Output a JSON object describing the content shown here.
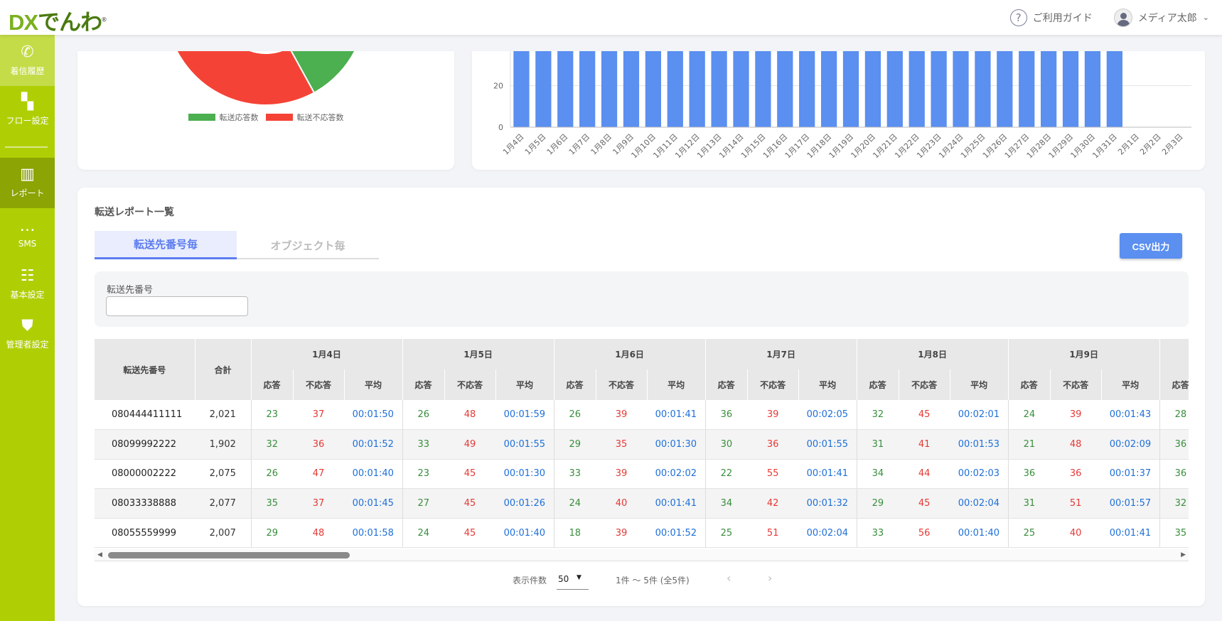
{
  "header": {
    "logo_dx": "DX",
    "logo_rest": "でんわ",
    "guide": "ご利用ガイド",
    "user": "メディア太郎"
  },
  "sidebar": {
    "items": [
      {
        "label": "着信履歴",
        "icon": "phone-icon"
      },
      {
        "label": "フロー設定",
        "icon": "flow-icon"
      },
      {
        "label": "レポート",
        "icon": "bar-chart-icon"
      },
      {
        "label": "SMS",
        "icon": "message-icon"
      },
      {
        "label": "基本設定",
        "icon": "sliders-icon"
      },
      {
        "label": "管理者設定",
        "icon": "admin-shield-icon"
      }
    ]
  },
  "chart_data": [
    {
      "type": "pie",
      "series": [
        {
          "name": "転送応答数",
          "color": "#4caf50",
          "share": 0.42
        },
        {
          "name": "転送不応答数",
          "color": "#f44336",
          "share": 0.58
        }
      ],
      "legend": "bottom"
    },
    {
      "type": "bar",
      "color": "#5b8ff0",
      "categories": [
        "1月4日",
        "1月5日",
        "1月6日",
        "1月7日",
        "1月8日",
        "1月9日",
        "1月10日",
        "1月11日",
        "1月12日",
        "1月13日",
        "1月14日",
        "1月15日",
        "1月16日",
        "1月17日",
        "1月18日",
        "1月19日",
        "1月20日",
        "1月21日",
        "1月22日",
        "1月23日",
        "1月24日",
        "1月25日",
        "1月26日",
        "1月27日",
        "1月28日",
        "1月29日",
        "1月30日",
        "1月31日",
        "2月1日",
        "2月2日",
        "2月3日"
      ],
      "values": [
        ">37",
        ">37",
        ">37",
        ">37",
        ">37",
        ">37",
        ">37",
        ">37",
        ">37",
        ">37",
        ">37",
        ">37",
        ">37",
        ">37",
        ">37",
        ">37",
        ">37",
        ">37",
        ">37",
        ">37",
        ">37",
        ">37",
        ">37",
        ">37",
        ">37",
        ">37",
        ">37",
        ">37",
        0,
        0,
        0
      ],
      "yticks": [
        "0",
        "20"
      ],
      "grid": true
    }
  ],
  "report": {
    "title": "転送レポート一覧",
    "tabs": [
      "転送先番号毎",
      "オブジェクト毎"
    ],
    "csv": "CSV出力",
    "filter_label": "転送先番号",
    "filter_value": "",
    "table": {
      "col_number": "転送先番号",
      "col_total": "合計",
      "sub": [
        "応答",
        "不応答",
        "平均"
      ],
      "dates": [
        "1月4日",
        "1月5日",
        "1月6日",
        "1月7日",
        "1月8日",
        "1月9日"
      ],
      "rows": [
        {
          "number": "080444411111",
          "total": "2,021",
          "cells": [
            [
              "23",
              "37",
              "00:01:50"
            ],
            [
              "26",
              "48",
              "00:01:59"
            ],
            [
              "26",
              "39",
              "00:01:41"
            ],
            [
              "36",
              "39",
              "00:02:05"
            ],
            [
              "32",
              "45",
              "00:02:01"
            ],
            [
              "24",
              "39",
              "00:01:43"
            ]
          ],
          "next": "28"
        },
        {
          "number": "08099992222",
          "total": "1,902",
          "cells": [
            [
              "32",
              "36",
              "00:01:52"
            ],
            [
              "33",
              "49",
              "00:01:55"
            ],
            [
              "29",
              "35",
              "00:01:30"
            ],
            [
              "30",
              "36",
              "00:01:55"
            ],
            [
              "31",
              "41",
              "00:01:53"
            ],
            [
              "21",
              "48",
              "00:02:09"
            ]
          ],
          "next": "36"
        },
        {
          "number": "08000002222",
          "total": "2,075",
          "cells": [
            [
              "26",
              "47",
              "00:01:40"
            ],
            [
              "23",
              "45",
              "00:01:30"
            ],
            [
              "33",
              "39",
              "00:02:02"
            ],
            [
              "22",
              "55",
              "00:01:41"
            ],
            [
              "34",
              "44",
              "00:02:03"
            ],
            [
              "36",
              "36",
              "00:01:37"
            ]
          ],
          "next": "36"
        },
        {
          "number": "08033338888",
          "total": "2,077",
          "cells": [
            [
              "35",
              "37",
              "00:01:45"
            ],
            [
              "27",
              "45",
              "00:01:26"
            ],
            [
              "24",
              "40",
              "00:01:41"
            ],
            [
              "34",
              "42",
              "00:01:32"
            ],
            [
              "29",
              "45",
              "00:02:04"
            ],
            [
              "31",
              "51",
              "00:01:57"
            ]
          ],
          "next": "32"
        },
        {
          "number": "08055559999",
          "total": "2,007",
          "cells": [
            [
              "29",
              "48",
              "00:01:58"
            ],
            [
              "24",
              "45",
              "00:01:40"
            ],
            [
              "18",
              "39",
              "00:01:52"
            ],
            [
              "25",
              "51",
              "00:02:04"
            ],
            [
              "33",
              "56",
              "00:01:40"
            ],
            [
              "25",
              "40",
              "00:01:41"
            ]
          ],
          "next": "35"
        }
      ]
    },
    "pager": {
      "label": "表示件数",
      "per_page": "50",
      "range": "1件 〜 5件 (全5件)"
    }
  }
}
